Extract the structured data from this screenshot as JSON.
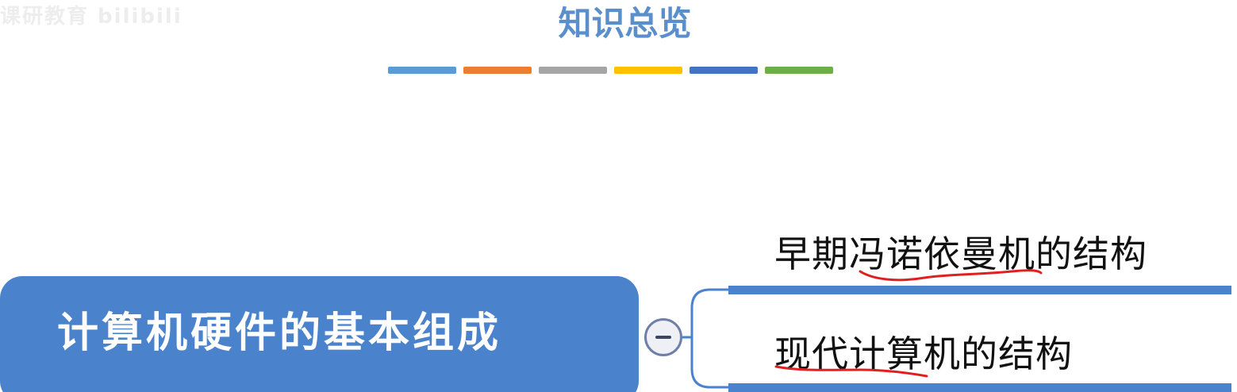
{
  "watermark": "课研教育 bilibili",
  "page": {
    "title": "知识总览",
    "title_color": "#5b8fcb"
  },
  "color_bars": [
    {
      "color": "#5b9bd5"
    },
    {
      "color": "#ed7d31"
    },
    {
      "color": "#a5a5a5"
    },
    {
      "color": "#ffc000"
    },
    {
      "color": "#4472c4"
    },
    {
      "color": "#70ad47"
    }
  ],
  "mindmap": {
    "root": {
      "label": "计算机硬件的基本组成",
      "color": "#4a82cc"
    },
    "branch_color": "#4a82cc",
    "annotation_color": "#e02020",
    "branches": [
      {
        "label": "早期冯诺依曼机的结构"
      },
      {
        "label": "现代计算机的结构"
      }
    ]
  }
}
